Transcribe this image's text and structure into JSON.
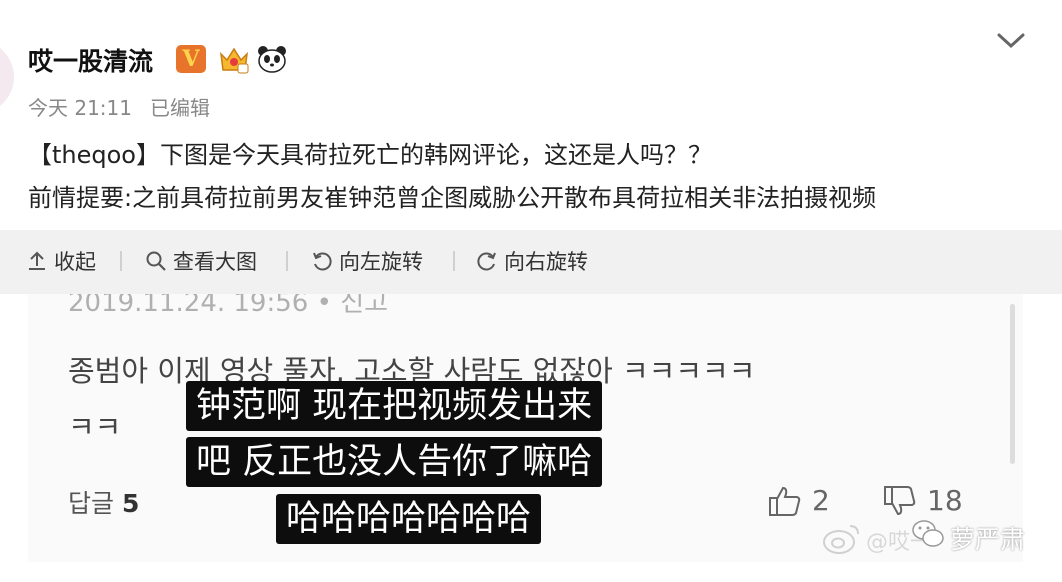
{
  "post": {
    "username": "哎一股清流",
    "verified_badge": "V",
    "time": "今天 21:11",
    "edited": "已编辑",
    "line1": "【theqoo】下图是今天具荷拉死亡的韩网评论，这还是人吗？？",
    "line2": "前情提要:之前具荷拉前男友崔钟范曾企图威胁公开散布具荷拉相关非法拍摄视频"
  },
  "toolbar": {
    "collapse": "收起",
    "view_large": "查看大图",
    "rotate_left": "向左旋转",
    "rotate_right": "向右旋转"
  },
  "image": {
    "date": "2019.11.24. 19:56 • 신고",
    "comment_line1": "종범아 이제 영상 풀자. 고소할 사람도 없잖아 ㅋㅋㅋㅋㅋ",
    "comment_line2": "ㅋㅋ",
    "reply_label": "답글",
    "reply_count": "5",
    "likes": "2",
    "dislikes": "18",
    "subtitle1": "钟范啊 现在把视频发出来",
    "subtitle2": "吧 反正也没人告你了嘛哈",
    "subtitle3": "哈哈哈哈哈哈哈"
  },
  "watermark": {
    "site_text": "@哎一",
    "author": "萝严肃"
  },
  "icons": {
    "collapse": "arrow-up-icon",
    "view": "search-icon",
    "rotate_left": "rotate-left-icon",
    "rotate_right": "rotate-right-icon",
    "menu": "chevron-down-icon"
  },
  "colors": {
    "badge_orange": "#e8742b",
    "toolbar_bg": "#f1f1f1",
    "subtitle_bg": "#0d0d0d"
  }
}
